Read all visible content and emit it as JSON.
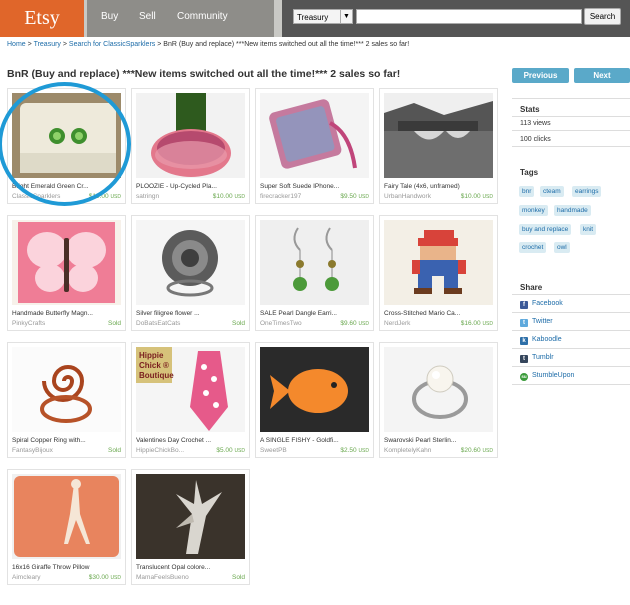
{
  "header": {
    "logo": "Etsy",
    "nav": [
      "Buy",
      "Sell",
      "Community"
    ],
    "search_select": "Treasury",
    "search_input_value": "",
    "search_button": "Search"
  },
  "breadcrumb": {
    "home": "Home",
    "treasury": "Treasury",
    "search": "Search for ClassicSparklers",
    "current": "BnR (Buy and replace) ***New items switched out all the time!*** 2 sales so far!",
    "sep": ">"
  },
  "page": {
    "title": "BnR (Buy and replace) ***New items switched out all the time!*** 2 sales so far!",
    "previous": "Previous",
    "next": "Next"
  },
  "items": [
    {
      "title": "Bright Emerald Green Cr...",
      "seller": "ClassicSparklers",
      "price": "$10.00",
      "currency": "USD",
      "sold": false,
      "icon": "green-earrings-icon"
    },
    {
      "title": "PLOOZIE - Up-Cycled Pla...",
      "seller": "satringn",
      "price": "$10.00",
      "currency": "USD",
      "sold": false,
      "icon": "bottle-cozy-icon"
    },
    {
      "title": "Super Soft Suede IPhone...",
      "seller": "firecracker197",
      "price": "$9.50",
      "currency": "USD",
      "sold": false,
      "icon": "knit-case-icon"
    },
    {
      "title": "Fairy Tale (4x6, unframed)",
      "seller": "UrbanHandwork",
      "price": "$10.00",
      "currency": "USD",
      "sold": false,
      "icon": "bridge-photo-icon"
    },
    {
      "title": "Handmade Butterfly Magn...",
      "seller": "PinkyCrafts",
      "price": "",
      "currency": "",
      "sold": true,
      "icon": "butterfly-icon"
    },
    {
      "title": "Silver filigree flower ...",
      "seller": "DoBatsEatCats",
      "price": "",
      "currency": "",
      "sold": true,
      "icon": "filigree-ring-icon"
    },
    {
      "title": "SALE Pearl Dangle Earri...",
      "seller": "OneTimesTwo",
      "price": "$9.60",
      "currency": "USD",
      "sold": false,
      "icon": "pearl-earrings-icon"
    },
    {
      "title": "Cross-Stitched Mario Ca...",
      "seller": "NerdJerk",
      "price": "$16.00",
      "currency": "USD",
      "sold": false,
      "icon": "mario-cross-stitch-icon"
    },
    {
      "title": "Spiral Copper Ring with...",
      "seller": "FantasyBijoux",
      "price": "",
      "currency": "",
      "sold": true,
      "icon": "copper-ring-icon"
    },
    {
      "title": "Valentines Day Crochet ...",
      "seller": "HippieChickBo...",
      "price": "$5.00",
      "currency": "USD",
      "sold": false,
      "icon": "crochet-tie-icon"
    },
    {
      "title": "A SINGLE FISHY - Goldfi...",
      "seller": "SweetPB",
      "price": "$2.50",
      "currency": "USD",
      "sold": false,
      "icon": "goldfish-icon"
    },
    {
      "title": "Swarovski Pearl Sterlin...",
      "seller": "KompletelyKahn",
      "price": "$20.60",
      "currency": "USD",
      "sold": false,
      "icon": "pearl-ring-icon"
    },
    {
      "title": "16x16 Giraffe Throw Pillow",
      "seller": "Aimcleary",
      "price": "$30.00",
      "currency": "USD",
      "sold": false,
      "icon": "giraffe-pillow-icon"
    },
    {
      "title": "Translucent Opal colore...",
      "seller": "MamaFeelsBueno",
      "price": "",
      "currency": "",
      "sold": true,
      "icon": "opal-leaf-icon"
    }
  ],
  "sold_label": "Sold",
  "thumb_text": {
    "hippie_chick_line1": "Hippie",
    "hippie_chick_line2": "Chick ®",
    "hippie_chick_line3": "Boutique"
  },
  "stats": {
    "heading": "Stats",
    "views": "113 views",
    "clicks": "100 clicks"
  },
  "tags": {
    "heading": "Tags",
    "list": [
      "bnr",
      "cteam",
      "earrings",
      "monkey",
      "handmade",
      "buy and replace",
      "knit",
      "crochet",
      "owl"
    ]
  },
  "share": {
    "heading": "Share",
    "list": [
      {
        "label": "Facebook",
        "icon": "facebook-icon",
        "color": "#3b5998",
        "glyph": "f"
      },
      {
        "label": "Twitter",
        "icon": "twitter-icon",
        "color": "#5ea9dd",
        "glyph": "t"
      },
      {
        "label": "Kaboodle",
        "icon": "kaboodle-icon",
        "color": "#2d6fa8",
        "glyph": "k"
      },
      {
        "label": "Tumblr",
        "icon": "tumblr-icon",
        "color": "#35465c",
        "glyph": "t"
      },
      {
        "label": "StumbleUpon",
        "icon": "stumbleupon-icon",
        "color": "#3a9a3a",
        "glyph": "su"
      }
    ]
  },
  "colors": {
    "etsy_orange": "#e0662a",
    "accent_blue": "#5aa9c9",
    "highlight_circle": "#1f9ad6",
    "price_green": "#6aa84f"
  }
}
